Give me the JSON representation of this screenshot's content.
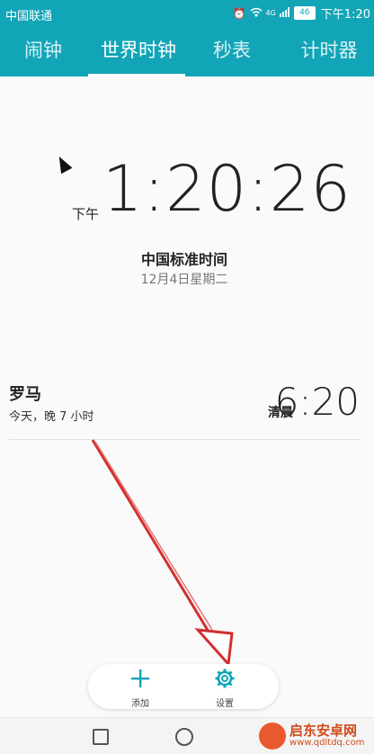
{
  "statusbar": {
    "carrier": "中国联通",
    "signal_label": "4G",
    "battery": "46",
    "time": "下午1:20"
  },
  "tabs": [
    {
      "label": "闹钟"
    },
    {
      "label": "世界时钟"
    },
    {
      "label": "秒表"
    },
    {
      "label": "计时器"
    }
  ],
  "clock": {
    "ampm": "下午",
    "time": "1:20:26",
    "timezone": "中国标准时间",
    "date": "12月4日星期二"
  },
  "cities": [
    {
      "name": "罗马",
      "offset": "今天，晚 7 小时",
      "ampm": "清晨",
      "time": "6:20"
    }
  ],
  "bottom_actions": {
    "add_label": "添加",
    "settings_label": "设置"
  },
  "watermark": {
    "name": "启东安卓网",
    "url": "www.qdltdq.com"
  },
  "colors": {
    "accent": "#12a5b7",
    "annotation_arrow": "#d32f2f"
  },
  "icons": {
    "add": "plus-icon",
    "settings": "gear-icon",
    "alarm": "alarm-clock-icon",
    "wifi": "wifi-icon",
    "signal": "signal-icon",
    "battery": "battery-icon"
  }
}
